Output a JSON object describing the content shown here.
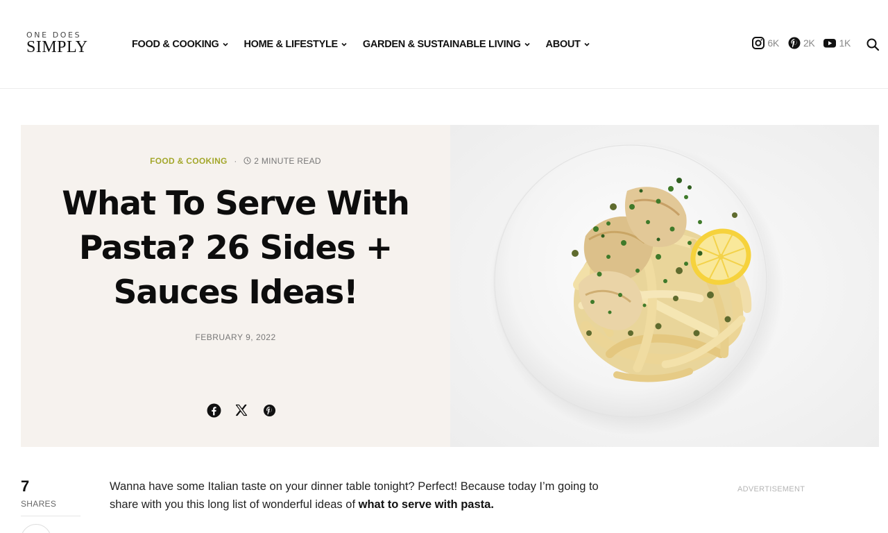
{
  "logo": {
    "line1": "ONE DOES",
    "line2": "SIMPLY"
  },
  "nav": [
    {
      "label": "FOOD & COOKING"
    },
    {
      "label": "HOME & LIFESTYLE"
    },
    {
      "label": "GARDEN & SUSTAINABLE LIVING"
    },
    {
      "label": "ABOUT"
    }
  ],
  "social": [
    {
      "icon": "instagram-icon",
      "count": "6K"
    },
    {
      "icon": "pinterest-icon",
      "count": "2K"
    },
    {
      "icon": "youtube-icon",
      "count": "1K"
    }
  ],
  "article": {
    "category": "FOOD & COOKING",
    "separator": "·",
    "read_time": "2 MINUTE READ",
    "title": "What To Serve With Pasta? 26 Sides + Sauces Ideas!",
    "date": "FEBRUARY 9, 2022",
    "share_icons": [
      "facebook-icon",
      "x-icon",
      "pinterest-icon"
    ],
    "intro_plain": "Wanna have some Italian taste on your dinner table tonight? Perfect! Because today I’m going to share with you this long list of wonderful ideas of ",
    "intro_bold": "what to serve with pasta."
  },
  "shares": {
    "count": "7",
    "label": "SHARES"
  },
  "advertisement_label": "ADVERTISEMENT",
  "colors": {
    "accent": "#a3a72b",
    "hero_bg": "#f6f2ee",
    "text": "#111111"
  }
}
